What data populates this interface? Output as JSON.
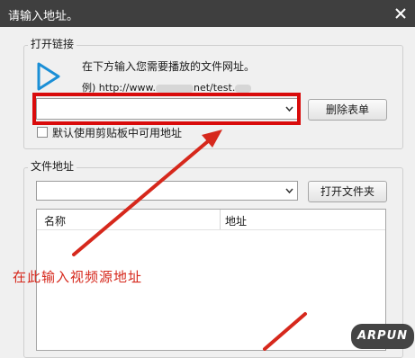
{
  "window": {
    "title": "请输入地址。"
  },
  "open_link": {
    "group_label": "打开链接",
    "hint_line1": "在下方输入您需要播放的文件网址。",
    "hint_example_prefix": "例) http://www.",
    "hint_example_mid": "net/test.",
    "url_value": "",
    "delete_button": "删除表单",
    "checkbox_label": "默认使用剪贴板中可用地址",
    "checkbox_checked": false
  },
  "file_address": {
    "group_label": "文件地址",
    "path_value": "",
    "open_folder_button": "打开文件夹",
    "columns": [
      "名称",
      "地址"
    ]
  },
  "annotation": {
    "text": "在此输入视频源地址",
    "color": "#d6281c"
  },
  "watermark": {
    "text": "ARPUN"
  },
  "colors": {
    "title_bar": "#3f3f3f",
    "highlight": "#d90b0b",
    "play_icon": "#1b8fd6"
  },
  "icons": {
    "play": "play-icon",
    "close": "close-icon",
    "dropdown": "chevron-down-icon"
  }
}
